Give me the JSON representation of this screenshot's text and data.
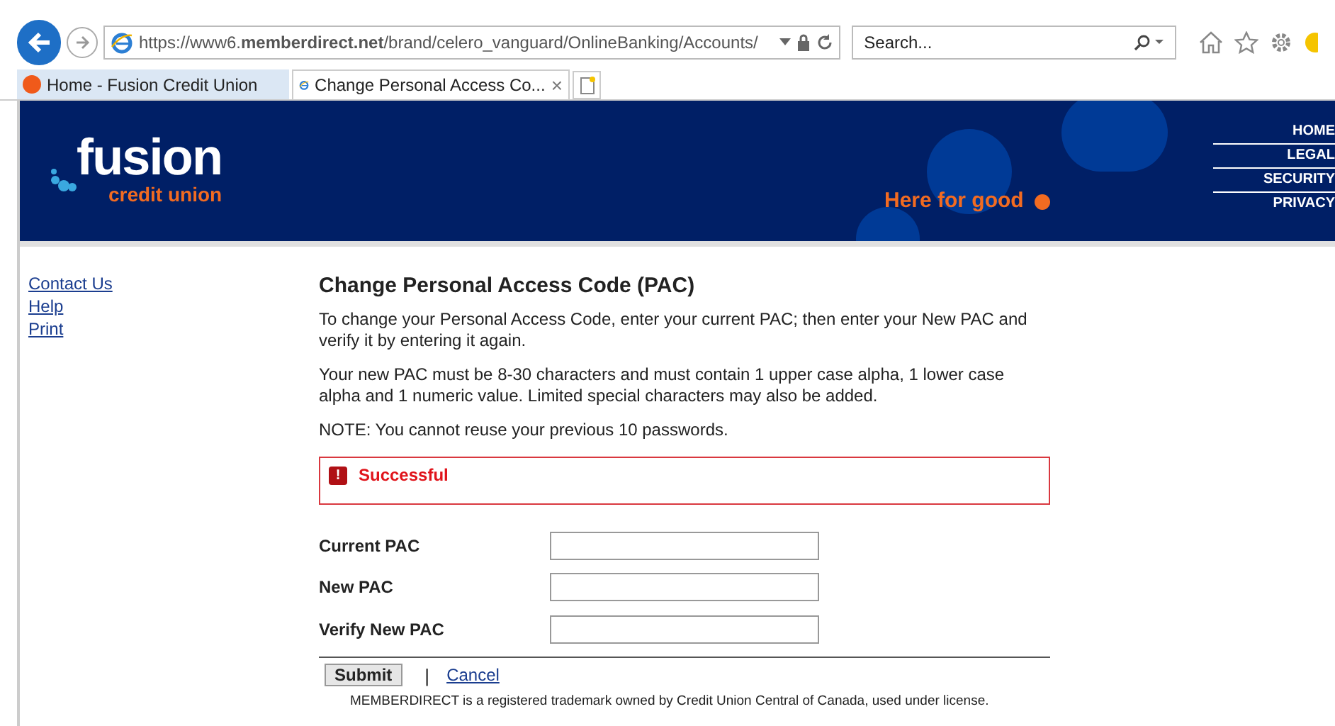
{
  "browser": {
    "address": "https://www6.**memberdirect.net**/brand/celero_vanguard/OnlineBanking/Accounts/",
    "search": {
      "placeholder": "Search..."
    },
    "tabs": [
      {
        "label": "Home - Fusion Credit Union",
        "selected": false,
        "kind": "dot"
      },
      {
        "label": "Change Personal Access Co...",
        "selected": true,
        "kind": "ie",
        "close": "×"
      }
    ]
  },
  "header": {
    "logo": {
      "name": "fusion",
      "sub": "credit union"
    },
    "tagline": "Here for good",
    "nav": [
      "HOME",
      "LEGAL",
      "SECURITY",
      "PRIVACY"
    ]
  },
  "sidebar": {
    "links": [
      "Contact Us",
      "Help",
      "Print"
    ]
  },
  "content": {
    "title": "Change Personal Access Code (PAC)",
    "paragraphs": [
      "To change your Personal Access Code, enter your current PAC; then enter your New PAC and verify it by entering it again.",
      "Your new PAC must be 8-30 characters and must contain 1 upper case alpha, 1 lower case alpha and 1 numeric value. Limited special characters may also be added.",
      "NOTE: You cannot reuse your previous 10 passwords."
    ],
    "alert": {
      "icon": "!",
      "message": "Successful"
    },
    "fields": [
      {
        "label": "Current PAC"
      },
      {
        "label": "New PAC"
      },
      {
        "label": "Verify New PAC"
      }
    ],
    "submit": "Submit",
    "separator": "|",
    "cancel": "Cancel",
    "footer": "MEMBERDIRECT is a registered trademark owned by Credit Union Central of Canada, used under license."
  }
}
